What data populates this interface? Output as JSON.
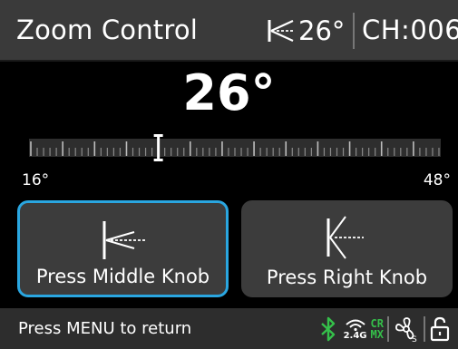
{
  "header": {
    "title": "Zoom Control",
    "angle": "26°",
    "channel": "CH:006",
    "icons": {
      "angle": "beam-angle-icon"
    }
  },
  "zoom": {
    "current": "26°",
    "min_label": "16°",
    "max_label": "48°",
    "min": 16,
    "max": 48,
    "value": 26
  },
  "buttons": {
    "middle": {
      "label": "Press Middle Knob",
      "icon": "narrow-beam-icon"
    },
    "right": {
      "label": "Press Right Knob",
      "icon": "wide-beam-icon"
    }
  },
  "footer": {
    "hint": "Press MENU to return",
    "wireless_label": "2.4G",
    "crmx_top": "CR",
    "crmx_bottom": "MX",
    "icons": [
      "bluetooth-icon",
      "wireless-2-4g-icon",
      "crmx-icon",
      "fan-icon",
      "unlock-icon"
    ]
  },
  "colors": {
    "accent": "#2aa6e0",
    "bluetooth": "#35c04a",
    "crmx": "#35c04a",
    "header_bg": "#3a3a3a",
    "button_bg": "#3c3c3c"
  }
}
